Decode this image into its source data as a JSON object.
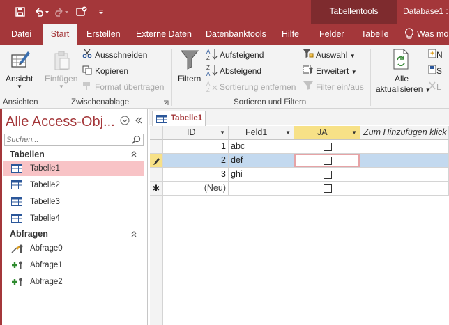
{
  "titlebar": {
    "context_group": "Tabellentools",
    "db_title": "Database1 : D"
  },
  "tabs": {
    "datei": "Datei",
    "start": "Start",
    "erstellen": "Erstellen",
    "externe": "Externe Daten",
    "datenbank": "Datenbanktools",
    "hilfe": "Hilfe",
    "felder": "Felder",
    "tabelle": "Tabelle",
    "search": "Was mö"
  },
  "ribbon": {
    "ansicht": "Ansicht",
    "ansichten_group": "Ansichten",
    "einfuegen": "Einfügen",
    "ausschneiden": "Ausschneiden",
    "kopieren": "Kopieren",
    "format": "Format übertragen",
    "zwischenablage_group": "Zwischenablage",
    "filtern": "Filtern",
    "aufsteigend": "Aufsteigend",
    "absteigend": "Absteigend",
    "sortierung": "Sortierung entfernen",
    "auswahl": "Auswahl",
    "erweitert": "Erweitert",
    "filter_toggle": "Filter ein/aus",
    "sortfilter_group": "Sortieren und Filtern",
    "alle": "Alle",
    "aktualisieren": "aktualisieren",
    "n_label": "N",
    "s_label": "S",
    "l_label": "L"
  },
  "nav": {
    "title": "Alle Access-Obj...",
    "search_placeholder": "Suchen...",
    "group_tables": "Tabellen",
    "group_queries": "Abfragen",
    "tables": [
      "Tabelle1",
      "Tabelle2",
      "Tabelle3",
      "Tabelle4"
    ],
    "queries": [
      "Abfrage0",
      "Abfrage1",
      "Abfrage2"
    ]
  },
  "doc": {
    "tab_label": "Tabelle1"
  },
  "datasheet": {
    "columns": [
      "ID",
      "Feld1",
      "JA",
      "Zum Hinzufügen klick"
    ],
    "rows": [
      {
        "id": "1",
        "feld1": "abc"
      },
      {
        "id": "2",
        "feld1": "def"
      },
      {
        "id": "3",
        "feld1": "ghi"
      }
    ],
    "new_row_label": "(Neu)"
  },
  "colors": {
    "accent": "#a4373a",
    "context_header": "#7e2b2e",
    "selected_row": "#c3d9ef",
    "selected_nav": "#f8c3c6"
  }
}
